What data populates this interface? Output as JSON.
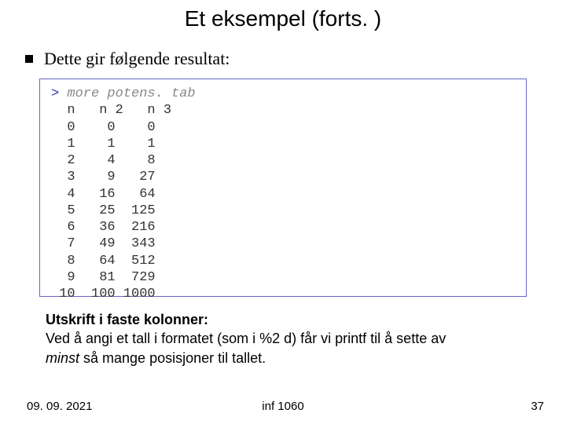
{
  "title": "Et eksempel (forts. )",
  "bullet": "Dette gir følgende resultat:",
  "code": {
    "prompt": ">",
    "command": "more potens. tab",
    "header": "  n   n 2   n 3",
    "rows": [
      "  0    0    0",
      "  1    1    1",
      "  2    4    8",
      "  3    9   27",
      "  4   16   64",
      "  5   25  125",
      "  6   36  216",
      "  7   49  343",
      "  8   64  512",
      "  9   81  729",
      " 10  100 1000"
    ]
  },
  "caption": {
    "strong": "Utskrift i faste kolonner:",
    "line2a": "Ved å angi et tall i formatet (som i %2 d) får vi printf til å sette av",
    "line3_em": "minst",
    "line3_rest": " så mange posisjoner til tallet."
  },
  "footer": {
    "date": "09. 09. 2021",
    "course": "inf 1060",
    "page": "37"
  },
  "chart_data": {
    "type": "table",
    "title": "more potens.tab",
    "columns": [
      "n",
      "n 2",
      "n 3"
    ],
    "rows": [
      [
        0,
        0,
        0
      ],
      [
        1,
        1,
        1
      ],
      [
        2,
        4,
        8
      ],
      [
        3,
        9,
        27
      ],
      [
        4,
        16,
        64
      ],
      [
        5,
        25,
        125
      ],
      [
        6,
        36,
        216
      ],
      [
        7,
        49,
        343
      ],
      [
        8,
        64,
        512
      ],
      [
        9,
        81,
        729
      ],
      [
        10,
        100,
        1000
      ]
    ]
  }
}
